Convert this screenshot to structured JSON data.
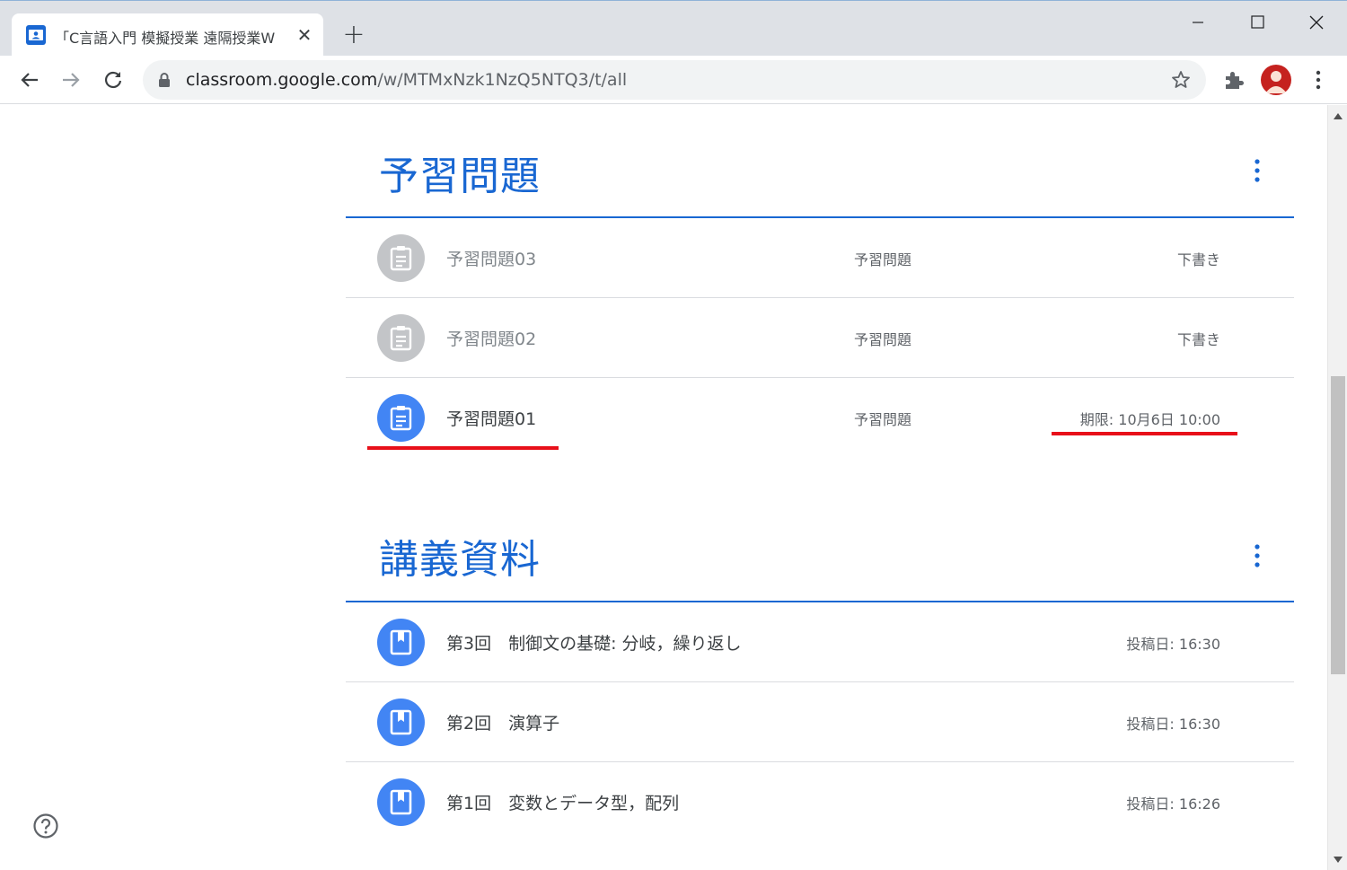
{
  "browser": {
    "tab_title": "「C言語入門 模擬授業 遠隔授業W",
    "new_tab_label": "+",
    "url_host": "classroom.google.com",
    "url_path": "/w/MTMxNzk1NzQ5NTQ3/t/all"
  },
  "sections": [
    {
      "title": "予習問題",
      "items": [
        {
          "title": "予習問題03",
          "topic": "予習問題",
          "status": "下書き",
          "state": "draft"
        },
        {
          "title": "予習問題02",
          "topic": "予習問題",
          "status": "下書き",
          "state": "draft"
        },
        {
          "title": "予習問題01",
          "topic": "予習問題",
          "status": "期限: 10月6日 10:00",
          "state": "assigned"
        }
      ]
    },
    {
      "title": "講義資料",
      "items": [
        {
          "title": "第3回　制御文の基礎: 分岐，繰り返し",
          "status": "投稿日: 16:30"
        },
        {
          "title": "第2回　演算子",
          "status": "投稿日: 16:30"
        },
        {
          "title": "第1回　変数とデータ型，配列",
          "status": "投稿日: 16:26"
        }
      ]
    }
  ],
  "colors": {
    "accent": "#1967d2",
    "icon_active": "#4285f4",
    "icon_draft": "#c3c5c8",
    "highlight": "#e8101a"
  },
  "icons": {
    "assignment": "clipboard-icon",
    "material": "book-icon",
    "help": "help-circle-icon"
  }
}
